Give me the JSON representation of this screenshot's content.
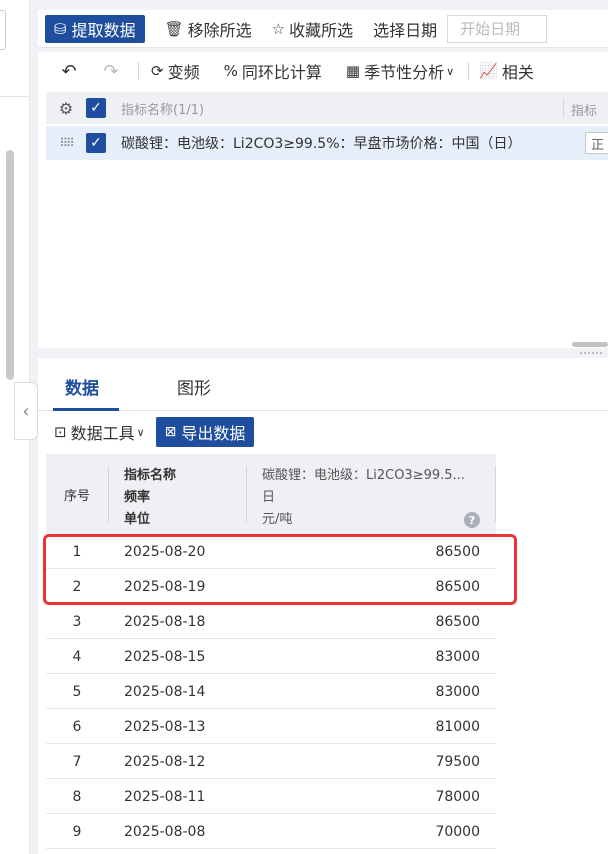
{
  "topbar": {
    "fetch_data": "提取数据",
    "remove_selected": "移除所选",
    "favorite_selected": "收藏所选",
    "select_date": "选择日期",
    "start_date_placeholder": "开始日期"
  },
  "toolbar2": {
    "frequency": "变频",
    "yoy_mom": "同环比计算",
    "seasonal": "季节性分析",
    "related": "相关"
  },
  "indicator_table": {
    "header_label": "指标名称(1/1)",
    "header_right": "指标",
    "row_label": "碳酸锂：电池级：Li2CO3≥99.5%：早盘市场价格：中国（日）",
    "row_status": "正"
  },
  "tabs": [
    {
      "label": "数据"
    },
    {
      "label": "图形"
    }
  ],
  "data_tools": {
    "tools_label": "数据工具",
    "export_label": "导出数据"
  },
  "data_table": {
    "seq_header": "序号",
    "meta_name": "指标名称",
    "meta_freq": "频率",
    "meta_unit": "单位",
    "series_name": "碳酸锂：电池级：Li2CO3≥99.5...",
    "series_freq": "日",
    "series_unit": "元/吨",
    "help": "?",
    "rows": [
      {
        "seq": "1",
        "date": "2025-08-20",
        "value": "86500"
      },
      {
        "seq": "2",
        "date": "2025-08-19",
        "value": "86500"
      },
      {
        "seq": "3",
        "date": "2025-08-18",
        "value": "86500"
      },
      {
        "seq": "4",
        "date": "2025-08-15",
        "value": "83000"
      },
      {
        "seq": "5",
        "date": "2025-08-14",
        "value": "83000"
      },
      {
        "seq": "6",
        "date": "2025-08-13",
        "value": "81000"
      },
      {
        "seq": "7",
        "date": "2025-08-12",
        "value": "79500"
      },
      {
        "seq": "8",
        "date": "2025-08-11",
        "value": "78000"
      },
      {
        "seq": "9",
        "date": "2025-08-08",
        "value": "70000"
      }
    ]
  },
  "colors": {
    "primary": "#1f4e9e",
    "highlight": "#e83434",
    "selected_row": "#e6eefa"
  }
}
